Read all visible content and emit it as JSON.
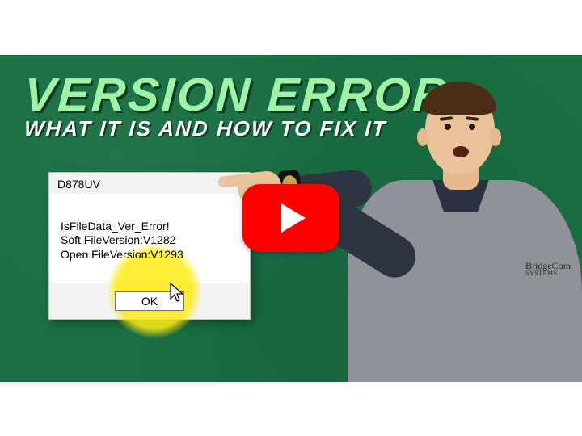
{
  "headline": {
    "line1": "VERSION ERROR",
    "line2": "WHAT IT IS AND HOW TO FIX IT"
  },
  "dialog": {
    "title": "D878UV",
    "lines": {
      "l1": "IsFileData_Ver_Error!",
      "l2": "Soft FileVersion:V1282",
      "l3": "Open FileVersion:V1293"
    },
    "ok_label": "OK"
  },
  "logo_top": "BridgeCom",
  "logo_bottom": "SYSTEMS"
}
